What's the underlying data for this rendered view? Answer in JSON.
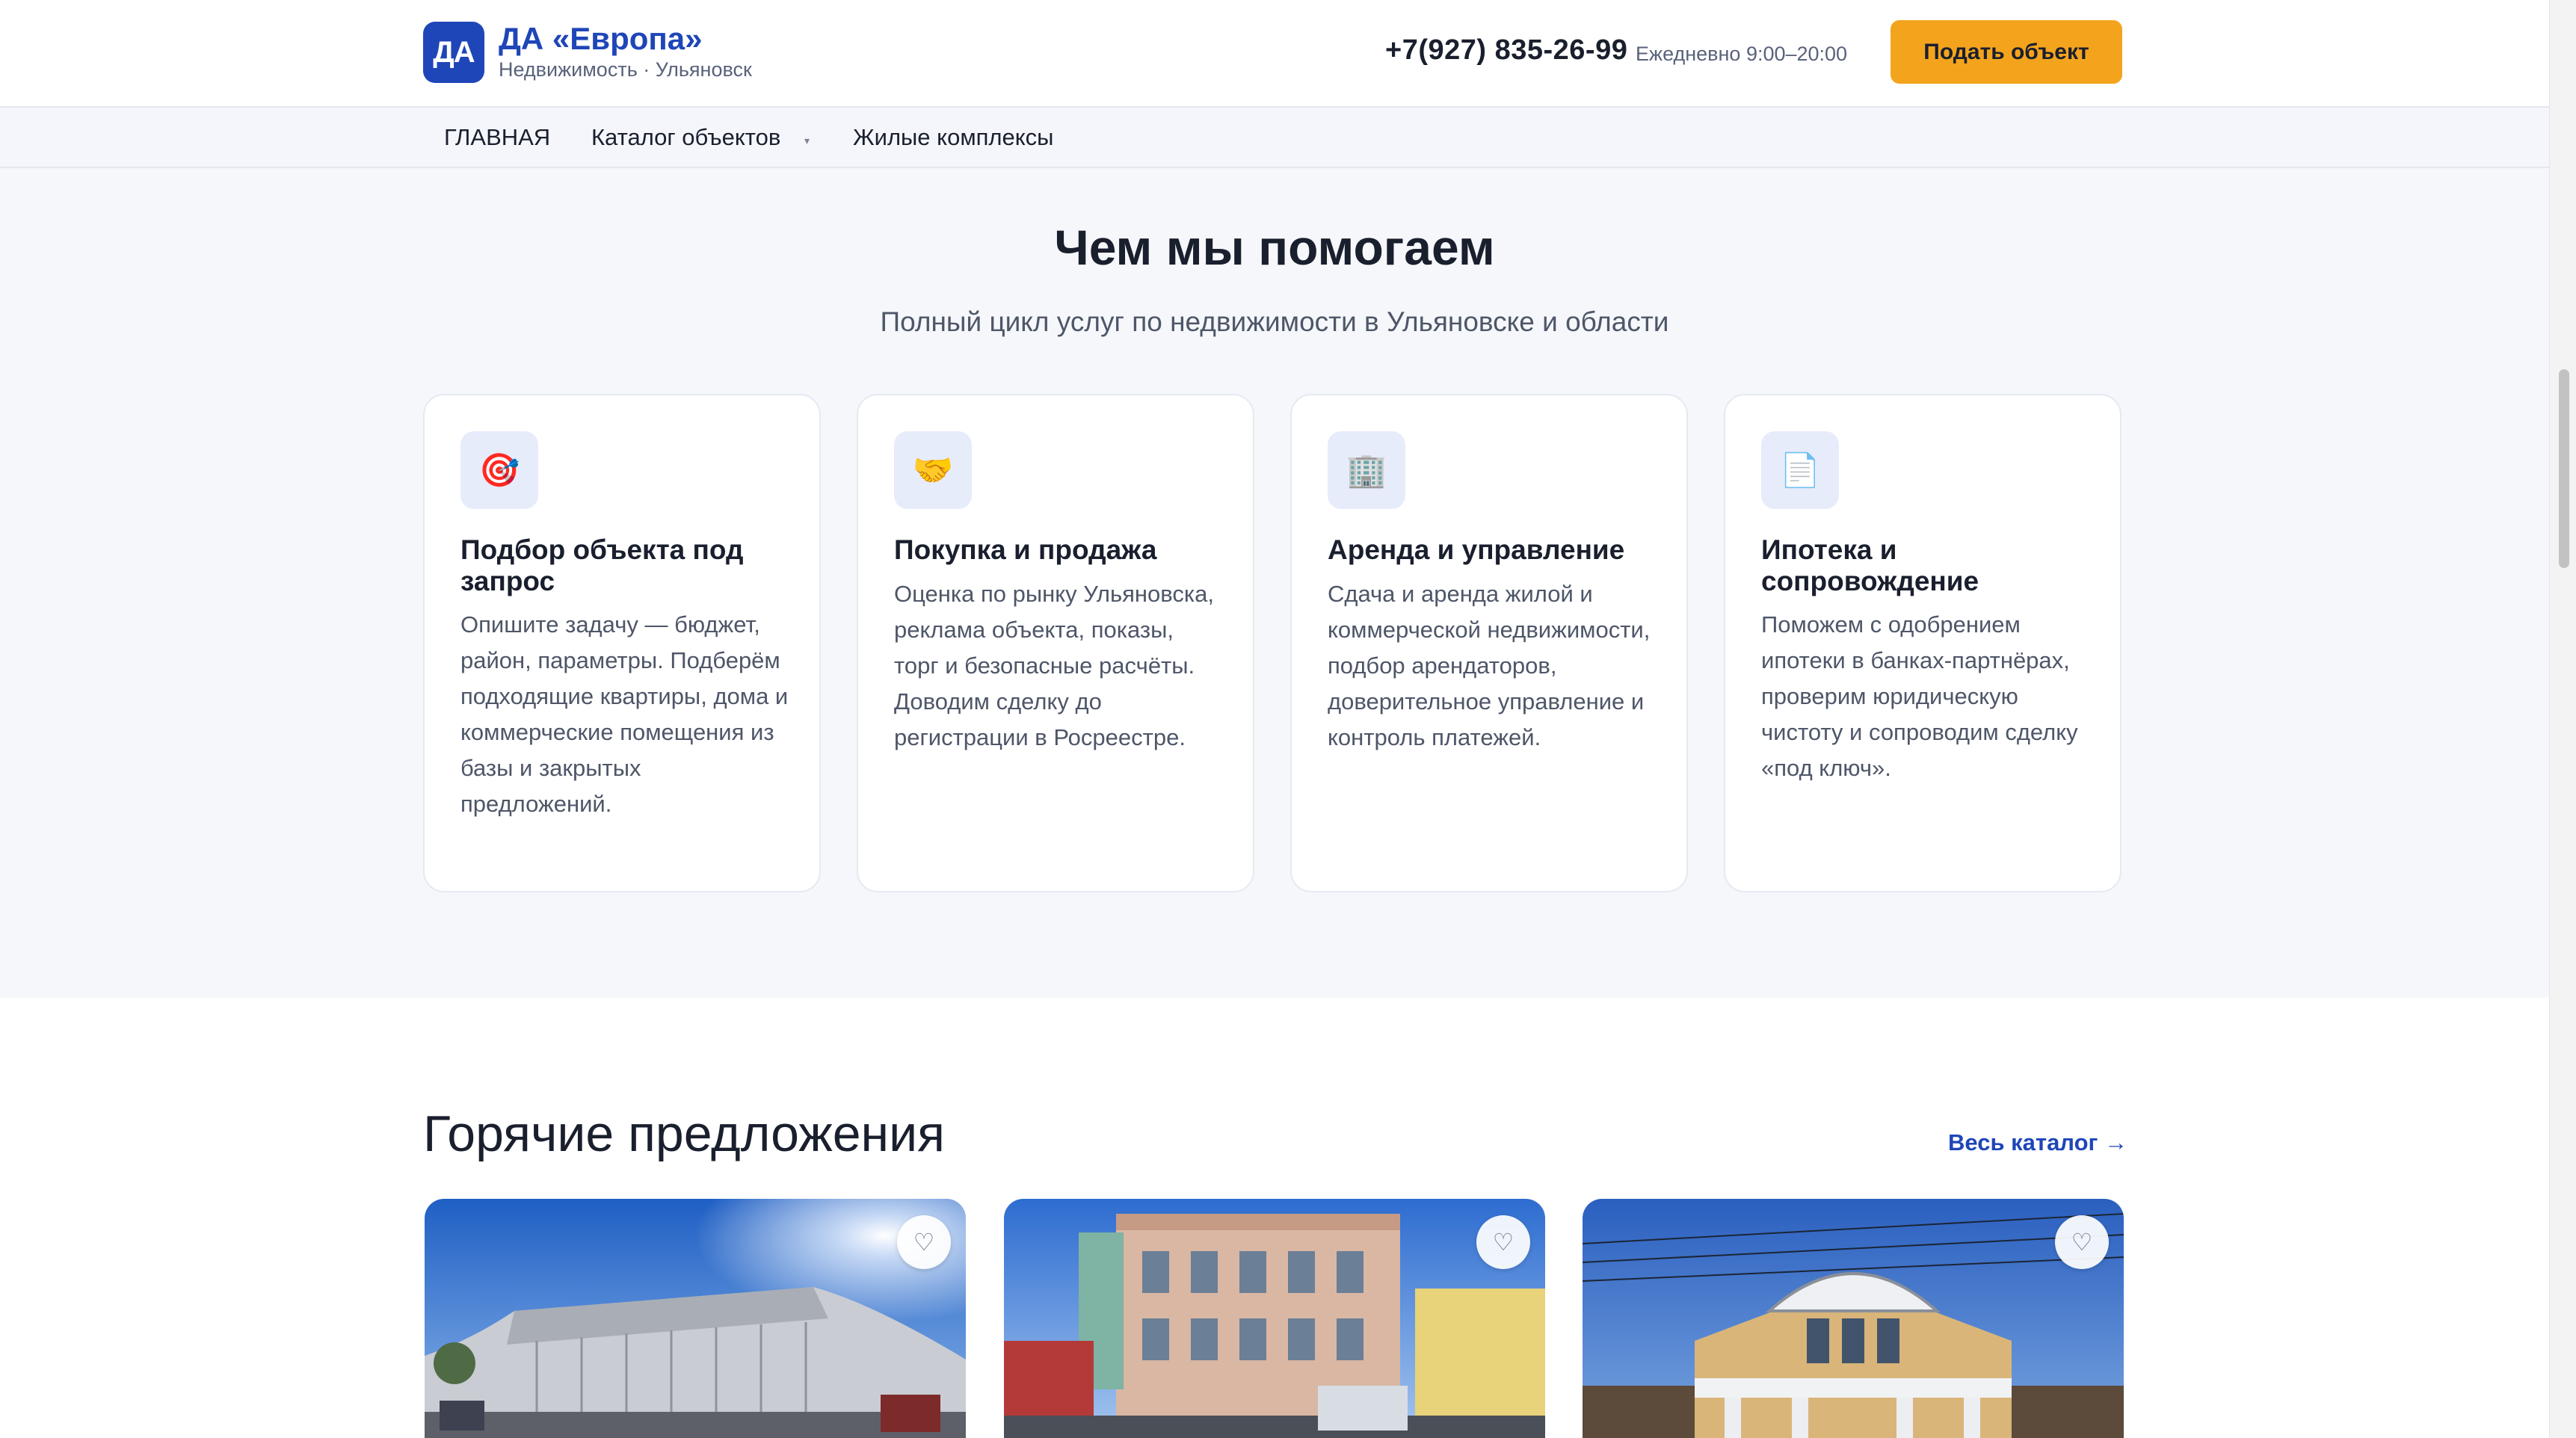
{
  "header": {
    "logo_text": "ДА",
    "brand_name": "ДА «Европа»",
    "brand_sub": "Недвижимость · Ульяновск",
    "phone": "+7(927) 835-26-99",
    "hours": "Ежедневно 9:00–20:00",
    "submit_label": "Подать объект"
  },
  "nav": {
    "home": "ГЛАВНАЯ",
    "catalog": "Каталог объектов",
    "catalog_caret": "▾",
    "complexes": "Жилые комплексы"
  },
  "services": {
    "title": "Чем мы помогаем",
    "subtitle": "Полный цикл услуг по недвижимости в Ульяновске и области",
    "cards": [
      {
        "icon": "target-icon",
        "glyph": "🎯",
        "title": "Подбор объекта под запрос",
        "text": "Опишите задачу — бюджет, район, параметры. Подберём подходящие квартиры, дома и коммерческие помещения из базы и закрытых предложений."
      },
      {
        "icon": "handshake-icon",
        "glyph": "🤝",
        "title": "Покупка и продажа",
        "text": "Оценка по рынку Ульяновска, реклама объекта, показы, торг и безопасные расчёты. Доводим сделку до регистрации в Росреестре."
      },
      {
        "icon": "office-building-icon",
        "glyph": "🏢",
        "title": "Аренда и управление",
        "text": "Сдача и аренда жилой и коммерческой недвижимости, подбор арендаторов, доверительное управление и контроль платежей."
      },
      {
        "icon": "document-icon",
        "glyph": "📄",
        "title": "Ипотека и сопровождение",
        "text": "Поможем с одобрением ипотеки в банках-партнёрах, проверим юридическую чистоту и сопроводим сделку «под ключ»."
      }
    ]
  },
  "hot": {
    "title": "Горячие предложения",
    "catalog_link": "Весь каталог →",
    "fav_glyph": "♡"
  }
}
